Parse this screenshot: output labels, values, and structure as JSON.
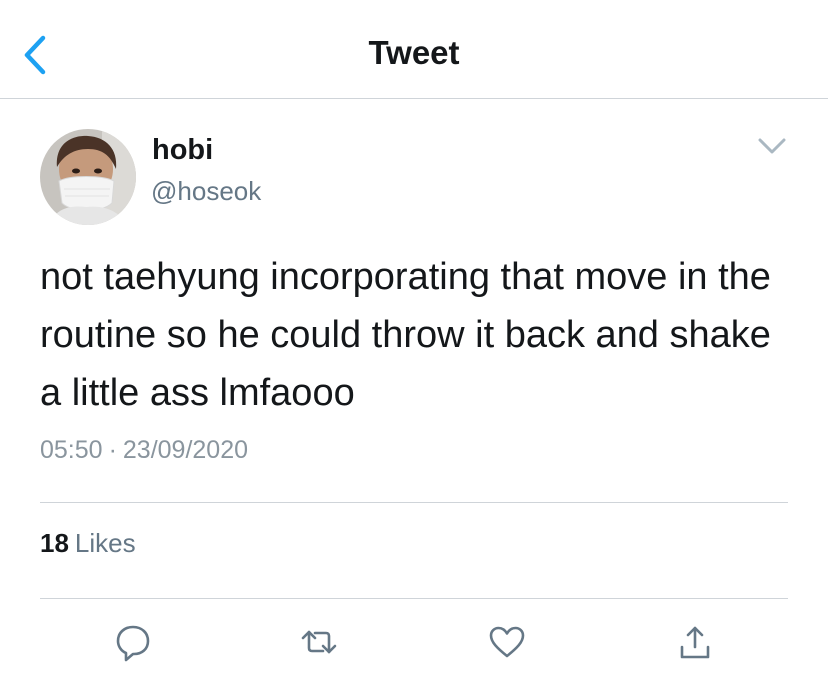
{
  "header": {
    "title": "Tweet",
    "back_icon": "chevron-left-icon"
  },
  "colors": {
    "accent": "#1da1f2",
    "text_primary": "#14171a",
    "text_secondary": "#657786",
    "divider": "#cfd4d9"
  },
  "tweet": {
    "author_name": "hobi",
    "author_handle": "@hoseok",
    "text": "not taehyung incorporating that move in the routine so he could throw it back and shake a little ass lmfaooo",
    "time": "05:50",
    "separator": "·",
    "date": "23/09/2020"
  },
  "stats": {
    "likes_count": "18",
    "likes_label": "Likes"
  },
  "actions": [
    {
      "name": "reply",
      "icon": "reply-icon"
    },
    {
      "name": "retweet",
      "icon": "retweet-icon"
    },
    {
      "name": "like",
      "icon": "heart-icon"
    },
    {
      "name": "share",
      "icon": "share-icon"
    }
  ]
}
